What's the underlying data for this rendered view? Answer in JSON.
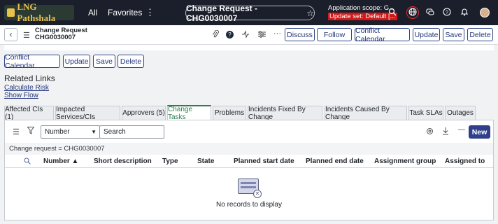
{
  "app": {
    "logo_text": "LNG Pathshala",
    "nav_all": "All",
    "nav_favorites": "Favorites",
    "nav_more": "⋮",
    "record_title": "Change Request - CHG0030007",
    "scope_line": "Application scope: G...",
    "update_set": "Update set: Default [...",
    "icons": [
      "search-icon",
      "globe-icon",
      "chat-icon",
      "help-icon",
      "bell-icon",
      "avatar"
    ]
  },
  "header": {
    "back": "‹",
    "title_line1": "Change Request",
    "title_line2": "CHG0030007",
    "buttons": {
      "discuss": "Discuss",
      "follow": "Follow",
      "conflict_calendar": "Conflict Calendar",
      "update": "Update",
      "save": "Save",
      "delete": "Delete"
    }
  },
  "form_buttons": {
    "conflict_calendar": "Conflict Calendar",
    "update": "Update",
    "save": "Save",
    "delete": "Delete"
  },
  "related_links": {
    "title": "Related Links",
    "links": [
      "Calculate Risk",
      "Show Flow"
    ]
  },
  "tabs": [
    "Affected CIs (1)",
    "Impacted Services/CIs",
    "Approvers (5)",
    "Change Tasks",
    "Problems",
    "Incidents Fixed By Change",
    "Incidents Caused By Change",
    "Task SLAs",
    "Outages"
  ],
  "active_tab": "Change Tasks",
  "list": {
    "field_select": "Number",
    "search_placeholder": "Search",
    "new_button": "New",
    "filter_text": "Change request = CHG0030007",
    "columns": [
      "Number ▲",
      "Short description",
      "Type",
      "State",
      "Planned start date",
      "Planned end date",
      "Assignment group",
      "Assigned to"
    ],
    "empty_message": "No records to display"
  },
  "colors": {
    "nav_bg": "#1a1f2b",
    "primary": "#2f3f8a",
    "active_tab": "#2e7d4f",
    "update_set_bg": "#d01818"
  }
}
